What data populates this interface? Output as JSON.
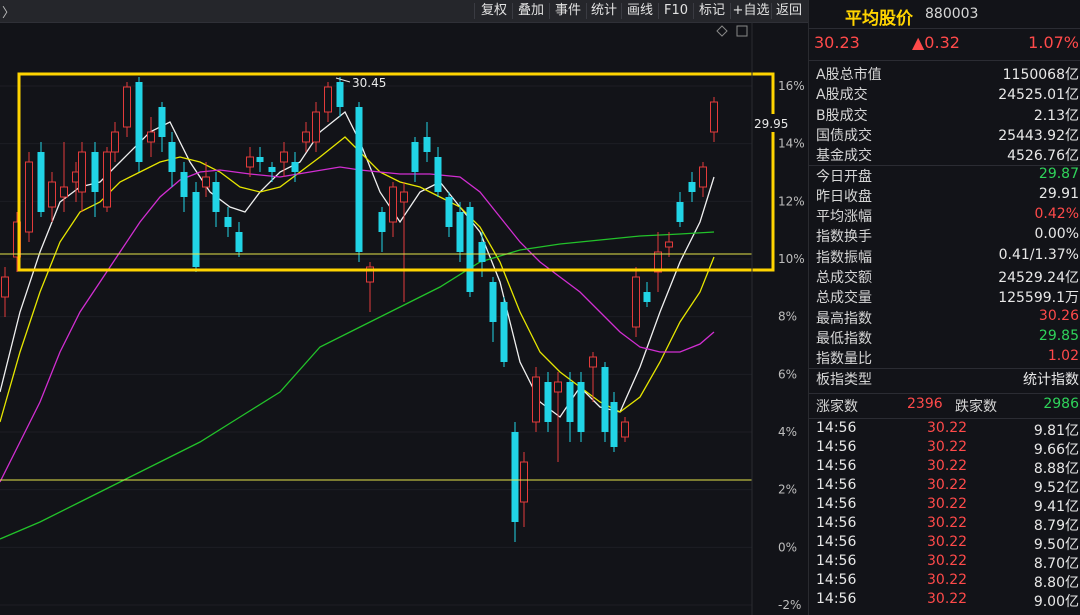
{
  "toolbar": {
    "back_chevron": "〉",
    "buttons": [
      "复权",
      "叠加",
      "事件",
      "统计",
      "画线",
      "F10",
      "标记",
      "+自选",
      "返回"
    ]
  },
  "chart": {
    "y_axis_labels": [
      "16%",
      "14%",
      "12%",
      "10%",
      "8%",
      "6%",
      "4%",
      "2%",
      "0%",
      "-2%"
    ],
    "price_annotation": "30.45",
    "current_price_tag": "29.95",
    "chart_data": {
      "type": "candlestick",
      "y_axis_unit": "percent change",
      "ylim": [
        -2,
        16
      ],
      "annotations": [
        {
          "text": "30.45",
          "meaning": "period high marker"
        },
        {
          "text": "29.95",
          "meaning": "current price label on right axis"
        }
      ],
      "moving_averages": [
        "white",
        "yellow",
        "magenta",
        "green"
      ],
      "highlight_box": {
        "color": "#ffd400"
      },
      "reference_lines": [
        "yellow horizontal at top band",
        "yellow horizontal near 2%"
      ]
    }
  },
  "panel": {
    "title": "平均股价",
    "code": "880003",
    "price": "30.23",
    "change": "▲0.32",
    "change_pct": "1.07%",
    "stats": [
      {
        "label": "A股总市值",
        "value": "1150068亿",
        "color": "white"
      },
      {
        "label": "A股成交",
        "value": "24525.01亿",
        "color": "white"
      },
      {
        "label": "B股成交",
        "value": "2.13亿",
        "color": "white"
      },
      {
        "label": "国债成交",
        "value": "25443.92亿",
        "color": "white"
      },
      {
        "label": "基金成交",
        "value": "4526.76亿",
        "color": "white"
      },
      {
        "label": "今日开盘",
        "value": "29.87",
        "color": "green"
      },
      {
        "label": "昨日收盘",
        "value": "29.91",
        "color": "white"
      },
      {
        "label": "平均涨幅",
        "value": "0.42%",
        "color": "red"
      },
      {
        "label": "指数换手",
        "value": "0.00%",
        "color": "white"
      },
      {
        "label": "指数振幅",
        "value": "0.41/1.37%",
        "color": "white"
      },
      {
        "label": "总成交额",
        "value": "24529.24亿",
        "color": "white"
      },
      {
        "label": "总成交量",
        "value": "125599.1万",
        "color": "white"
      },
      {
        "label": "最高指数",
        "value": "30.26",
        "color": "red"
      },
      {
        "label": "最低指数",
        "value": "29.85",
        "color": "green"
      },
      {
        "label": "指数量比",
        "value": "1.02",
        "color": "red"
      },
      {
        "label": "板指类型",
        "value": "统计指数",
        "color": "white"
      }
    ],
    "up_label": "涨家数",
    "up_value": "2396",
    "down_label": "跌家数",
    "down_value": "2986",
    "ticks": [
      {
        "time": "14:56",
        "price": "30.22",
        "amount": "9.81亿"
      },
      {
        "time": "14:56",
        "price": "30.22",
        "amount": "9.66亿"
      },
      {
        "time": "14:56",
        "price": "30.22",
        "amount": "8.88亿"
      },
      {
        "time": "14:56",
        "price": "30.22",
        "amount": "9.52亿"
      },
      {
        "time": "14:56",
        "price": "30.22",
        "amount": "9.41亿"
      },
      {
        "time": "14:56",
        "price": "30.22",
        "amount": "8.79亿"
      },
      {
        "time": "14:56",
        "price": "30.22",
        "amount": "9.50亿"
      },
      {
        "time": "14:56",
        "price": "30.22",
        "amount": "8.70亿"
      },
      {
        "time": "14:56",
        "price": "30.22",
        "amount": "8.80亿"
      },
      {
        "time": "14:56",
        "price": "30.22",
        "amount": "9.00亿"
      }
    ],
    "colors": {
      "up": "#ff4a4a",
      "down": "#2fd35a",
      "title": "#ffd400",
      "box": "#ffd400"
    }
  }
}
